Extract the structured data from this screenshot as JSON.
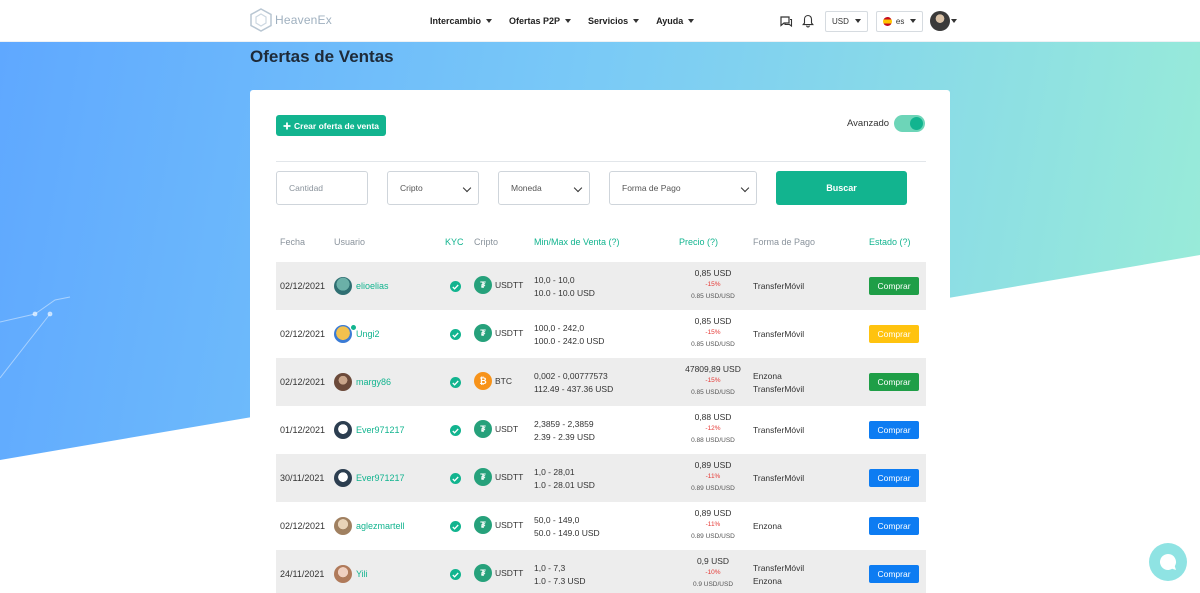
{
  "brand": {
    "name": "HeavenEx"
  },
  "nav": {
    "items": [
      {
        "label": "Intercambio"
      },
      {
        "label": "Ofertas P2P"
      },
      {
        "label": "Servicios"
      },
      {
        "label": "Ayuda"
      }
    ],
    "currency": "USD",
    "language": "es"
  },
  "page": {
    "title": "Ofertas de Ventas"
  },
  "toolbar": {
    "create_label": "Crear oferta de venta",
    "advanced_label": "Avanzado",
    "advanced_on": true
  },
  "filters": {
    "amount_placeholder": "Cantidad",
    "crypto": "Cripto",
    "currency": "Moneda",
    "payment": "Forma de Pago",
    "search_label": "Buscar"
  },
  "table": {
    "headers": [
      "Fecha",
      "Usuario",
      "KYC",
      "Cripto",
      "Min/Max de Venta (?)",
      "Precio (?)",
      "Forma de Pago",
      "Estado (?)"
    ],
    "rows": [
      {
        "date": "02/12/2021",
        "user": "elioelias",
        "crypto": "USDTT",
        "coin": "usdt",
        "range": "10,0 - 10,0",
        "range_usd": "10.0 - 10.0 USD",
        "price": "0,85 USD",
        "pct": "-15%",
        "unit": "0.85 USD/USD",
        "payment": [
          "TransferMóvil"
        ],
        "action": "Comprar",
        "action_color": "green"
      },
      {
        "date": "02/12/2021",
        "user": "Ungi2",
        "crypto": "USDTT",
        "coin": "usdt",
        "range": "100,0 - 242,0",
        "range_usd": "100.0 - 242.0 USD",
        "price": "0,85 USD",
        "pct": "-15%",
        "unit": "0.85 USD/USD",
        "payment": [
          "TransferMóvil"
        ],
        "action": "Comprar",
        "action_color": "yellow"
      },
      {
        "date": "02/12/2021",
        "user": "margy86",
        "crypto": "BTC",
        "coin": "btc",
        "range": "0,002 - 0,00777573",
        "range_usd": "112.49 - 437.36 USD",
        "price": "47809,89 USD",
        "pct": "-15%",
        "unit": "0.85 USD/USD",
        "payment": [
          "Enzona",
          "TransferMóvil"
        ],
        "action": "Comprar",
        "action_color": "green"
      },
      {
        "date": "01/12/2021",
        "user": "Ever971217",
        "crypto": "USDT",
        "coin": "usdt",
        "range": "2,3859 - 2,3859",
        "range_usd": "2.39 - 2.39 USD",
        "price": "0,88 USD",
        "pct": "-12%",
        "unit": "0.88 USD/USD",
        "payment": [
          "TransferMóvil"
        ],
        "action": "Comprar",
        "action_color": "blue"
      },
      {
        "date": "30/11/2021",
        "user": "Ever971217",
        "crypto": "USDTT",
        "coin": "usdt",
        "range": "1,0 - 28,01",
        "range_usd": "1.0 - 28.01 USD",
        "price": "0,89 USD",
        "pct": "-11%",
        "unit": "0.89 USD/USD",
        "payment": [
          "TransferMóvil"
        ],
        "action": "Comprar",
        "action_color": "blue"
      },
      {
        "date": "02/12/2021",
        "user": "aglezmartell",
        "crypto": "USDTT",
        "coin": "usdt",
        "range": "50,0 - 149,0",
        "range_usd": "50.0 - 149.0 USD",
        "price": "0,89 USD",
        "pct": "-11%",
        "unit": "0.89 USD/USD",
        "payment": [
          "Enzona"
        ],
        "action": "Comprar",
        "action_color": "blue"
      },
      {
        "date": "24/11/2021",
        "user": "Yili",
        "crypto": "USDTT",
        "coin": "usdt",
        "range": "1,0 - 7,3",
        "range_usd": "1.0 - 7.3 USD",
        "price": "0,9 USD",
        "pct": "-10%",
        "unit": "0.9 USD/USD",
        "payment": [
          "TransferMóvil",
          "Enzona"
        ],
        "action": "Comprar",
        "action_color": "blue"
      }
    ]
  },
  "colors": {
    "accent": "#12b48f",
    "buy_green": "#1f9e47",
    "buy_yellow": "#ffc30f",
    "buy_blue": "#0d7cf2",
    "discount": "#e53935"
  }
}
